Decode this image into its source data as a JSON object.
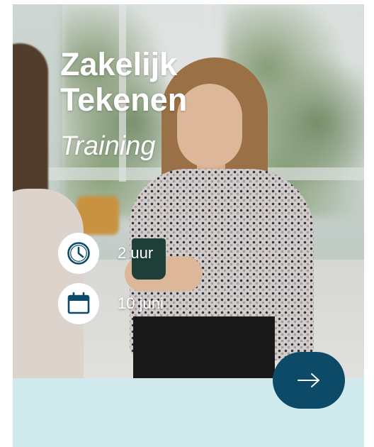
{
  "card": {
    "title_line1": "Zakelijk",
    "title_line2": "Tekenen",
    "subtitle": "Training",
    "duration": "2 uur",
    "date": "10 juni"
  },
  "icons": {
    "duration": "clock-icon",
    "date": "calendar-icon",
    "cta": "arrow-right-icon"
  },
  "colors": {
    "icon_navy": "#0d4a67",
    "cta_background": "#0d4a67",
    "footer_background": "#cfe9ec",
    "text_on_photo": "#ffffff"
  }
}
